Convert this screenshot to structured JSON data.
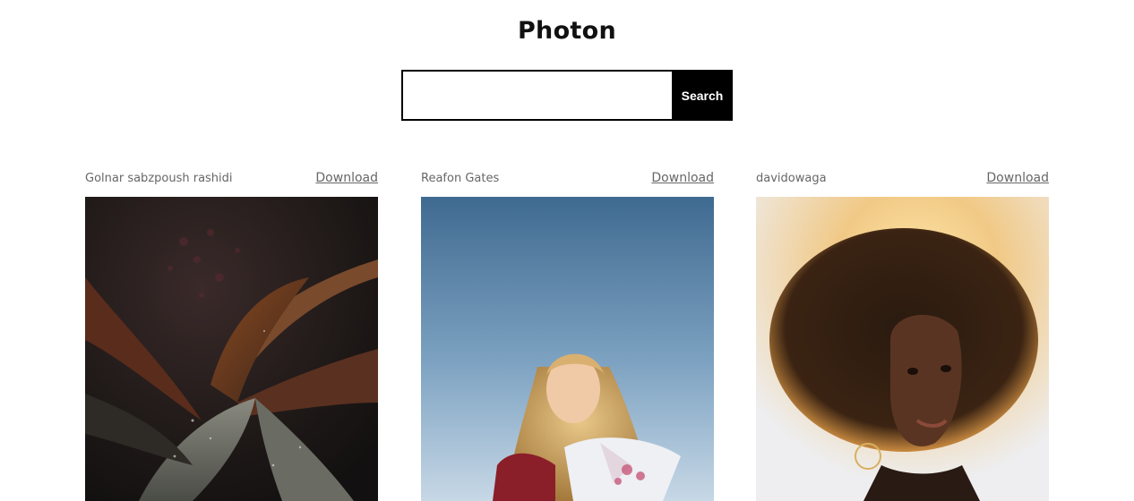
{
  "app": {
    "title": "Photon"
  },
  "search": {
    "placeholder": "",
    "value": "",
    "button_label": "Search"
  },
  "photos": [
    {
      "author": "Golnar sabzpoush rashidi",
      "download_label": "Download",
      "subject": "dark leaves with water droplets"
    },
    {
      "author": "Reafon Gates",
      "download_label": "Download",
      "subject": "woman holding bouquet against blue sky"
    },
    {
      "author": "davidowaga",
      "download_label": "Download",
      "subject": "woman with curly hair backlit by sun"
    }
  ]
}
